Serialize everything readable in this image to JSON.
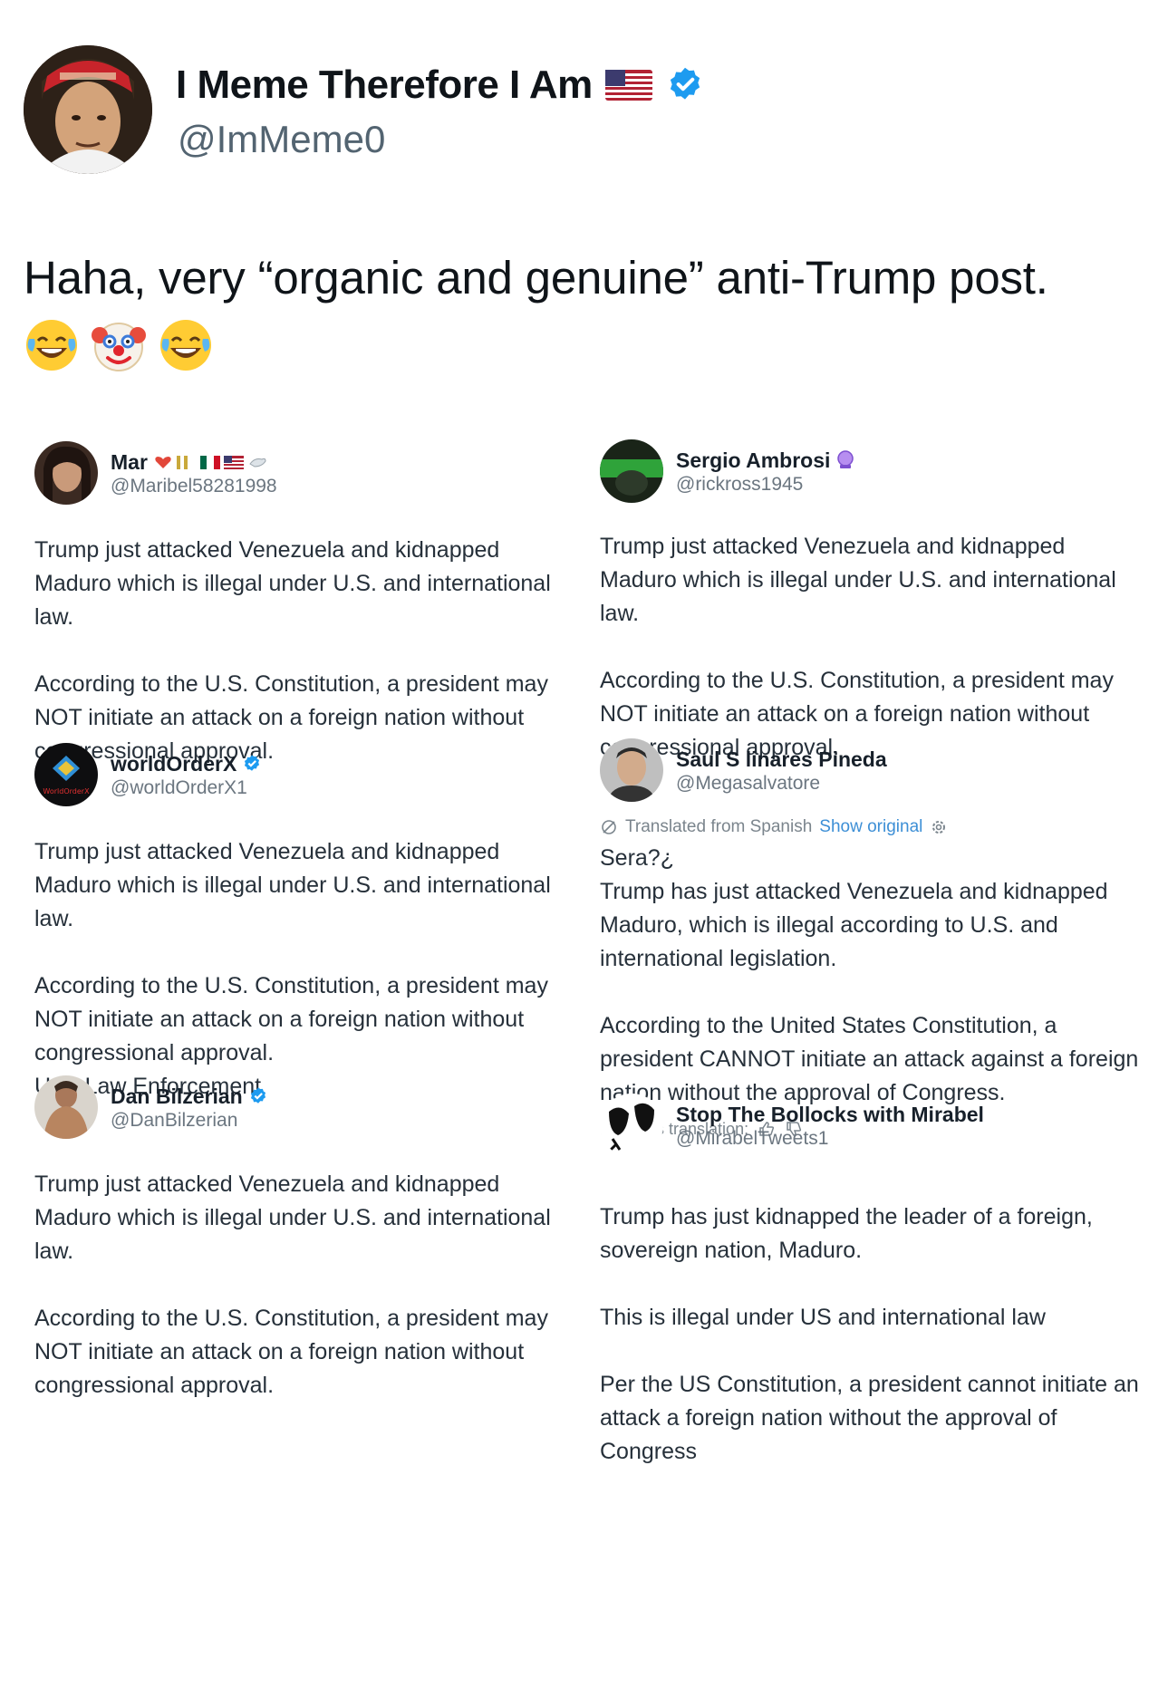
{
  "post": {
    "display_name": "I Meme Therefore I Am",
    "handle": "@ImMeme0",
    "flag_icon": "us-flag-icon",
    "verified_icon": "verified-badge-icon",
    "text": "Haha, very “organic and genuine” anti-Trump post.",
    "emojis": [
      "face-with-tears-of-joy-icon",
      "clown-face-icon",
      "face-with-tears-of-joy-icon"
    ]
  },
  "embedded": {
    "left": [
      {
        "name": "Mar",
        "handle": "@Maribel58281998",
        "paragraphs": [
          "Trump just attacked Venezuela and kidnapped Maduro which is illegal under U.S. and international law.",
          "According to the U.S. Constitution, a president may NOT initiate an attack on a foreign nation without congressional approval."
        ]
      },
      {
        "name": "worldOrderX",
        "handle": "@worldOrderX1",
        "avatar_text": "WorldOrderX",
        "paragraphs": [
          "Trump just attacked Venezuela and kidnapped Maduro which is illegal under U.S. and international law.",
          "According to the U.S. Constitution, a president may NOT initiate an attack on a foreign nation without congressional approval.",
          "U.S. Law Enforcement"
        ]
      },
      {
        "name": "Dan Bilzerian",
        "handle": "@DanBilzerian",
        "paragraphs": [
          "Trump just attacked Venezuela and kidnapped Maduro which is illegal under U.S. and international law.",
          "According to the U.S. Constitution, a president may NOT initiate an attack on a foreign nation without congressional approval."
        ]
      }
    ],
    "right": [
      {
        "name": "Sergio Ambrosi",
        "handle": "@rickross1945",
        "paragraphs": [
          "Trump just attacked Venezuela and kidnapped Maduro which is illegal under U.S. and international law.",
          "According to the U.S. Constitution, a president may NOT initiate an attack on a foreign nation without congressional approval."
        ]
      },
      {
        "name": "Saul S linares Pineda",
        "handle": "@Megasalvatore",
        "translated_label": "Translated from Spanish",
        "show_original": "Show original",
        "paragraphs": [
          "Sera?¿",
          "Trump has just attacked Venezuela and kidnapped Maduro, which is illegal according to U.S. and international legislation.",
          "According to the United States Constitution, a president CANNOT initiate an attack against a foreign nation without the approval of Congress."
        ],
        "rate_label": "Rate this translation:"
      },
      {
        "name": "Stop The Bollocks with Mirabel",
        "handle": "@MirabelTweets1",
        "paragraphs": [
          "Trump has just kidnapped the leader of a foreign, sovereign nation, Maduro.",
          "This is illegal under US and international law",
          "Per the US Constitution, a president cannot initiate an attack a foreign nation without the approval of Congress"
        ]
      }
    ]
  },
  "colors": {
    "verified": "#1d9bf0",
    "handle": "#536471",
    "link": "#3d8fd6"
  }
}
